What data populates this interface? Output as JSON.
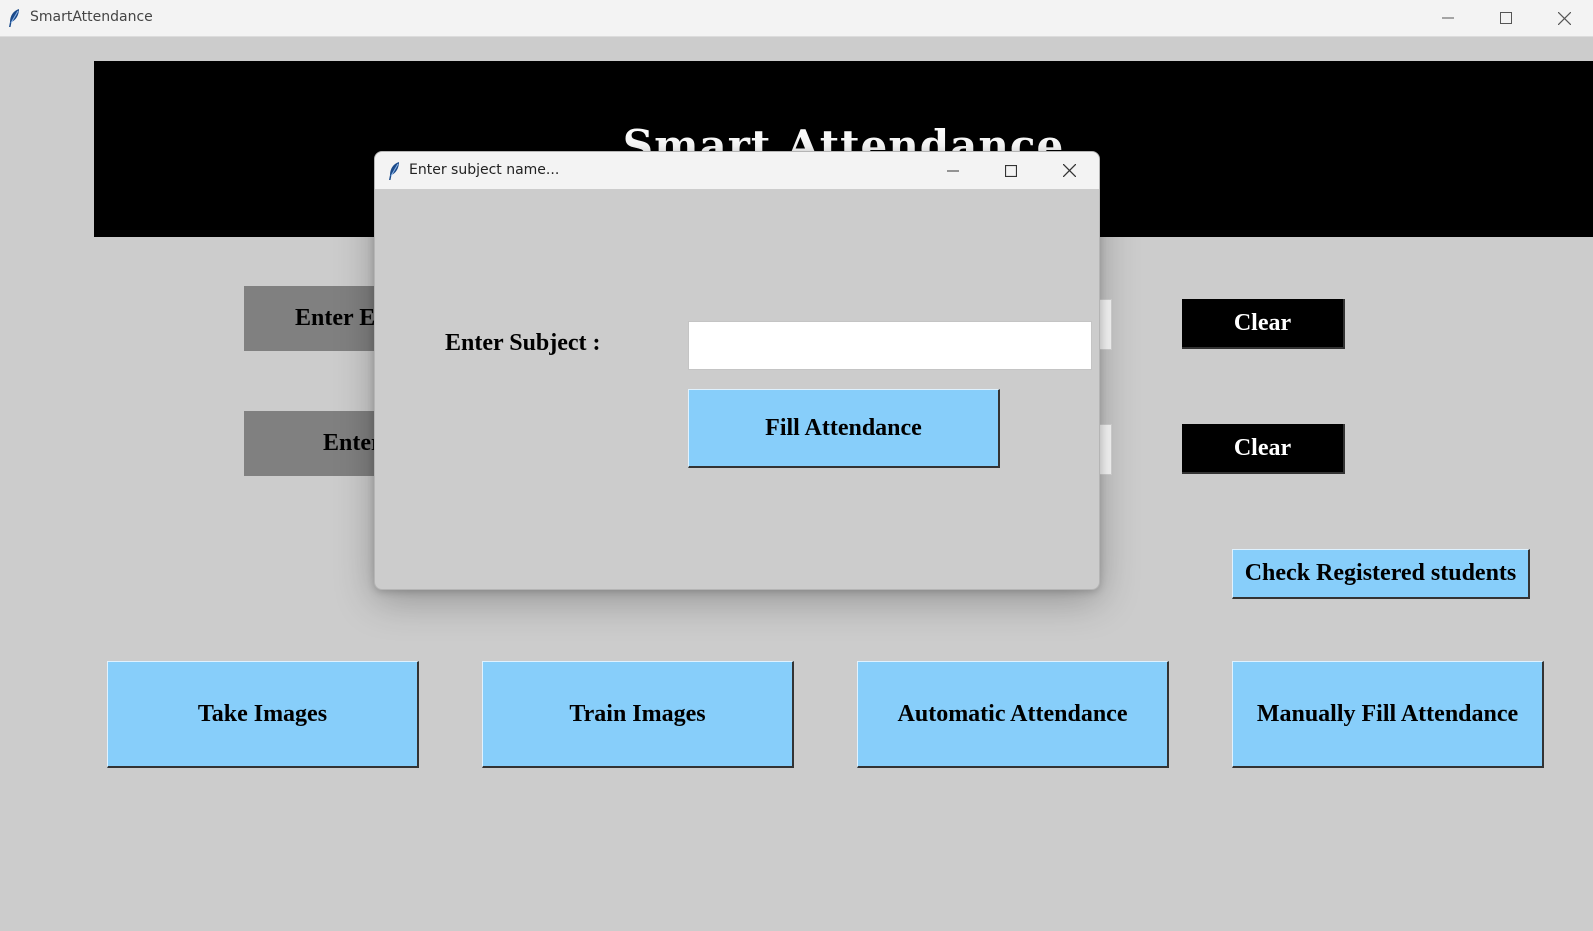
{
  "window": {
    "title": "SmartAttendance"
  },
  "header": {
    "title": "Smart Attendance"
  },
  "form": {
    "enrollment_label": "Enter Enrollment",
    "name_label": "Enter Name",
    "clear_label_1": "Clear",
    "clear_label_2": "Clear"
  },
  "check_registered_label": "Check Registered students",
  "actions": {
    "take_images": "Take Images",
    "train_images": "Train Images",
    "automatic_attendance": "Automatic Attendance",
    "manual_attendance": "Manually Fill Attendance"
  },
  "dialog": {
    "title": "Enter subject name...",
    "subject_label": "Enter Subject :",
    "subject_value": "",
    "fill_button": "Fill Attendance"
  },
  "icons": {
    "app": "feather-icon",
    "minimize": "minimize-icon",
    "maximize": "maximize-icon",
    "close": "close-icon"
  },
  "colors": {
    "background": "#cccccc",
    "header_bg": "#000000",
    "blue_button": "#87cefa",
    "gray_label": "#808080"
  }
}
